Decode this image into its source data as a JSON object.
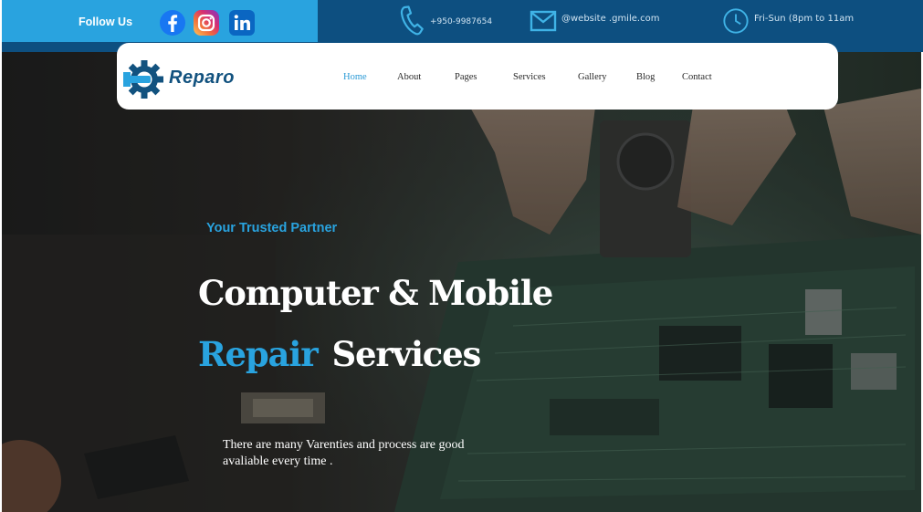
{
  "topbar": {
    "follow_label": "Follow Us",
    "social": [
      {
        "name": "facebook",
        "icon": "facebook-icon"
      },
      {
        "name": "instagram",
        "icon": "instagram-icon"
      },
      {
        "name": "linkedin",
        "icon": "linkedin-icon"
      }
    ],
    "phone": "+950-9987654",
    "email": "@website .gmile.com",
    "hours": "Fri-Sun (8pm to 11am"
  },
  "brand": {
    "name": "Reparo",
    "logo_icon": "gear-wrench-icon"
  },
  "nav": {
    "items": [
      "Home",
      "About",
      "Pages",
      "Services",
      "Gallery",
      "Blog",
      "Contact"
    ],
    "active": "Home"
  },
  "hero": {
    "tagline": "Your Trusted Partner",
    "headline_line1": "Computer & Mobile",
    "headline_accent": "Repair",
    "headline_rest": "Services",
    "description": "There are many Varenties and process are good\n avaliable  every time ."
  },
  "colors": {
    "accent": "#29a3df",
    "topbar_dark": "#0d4f80",
    "brand_text": "#12527f",
    "nav_active": "#2a9ad6"
  }
}
